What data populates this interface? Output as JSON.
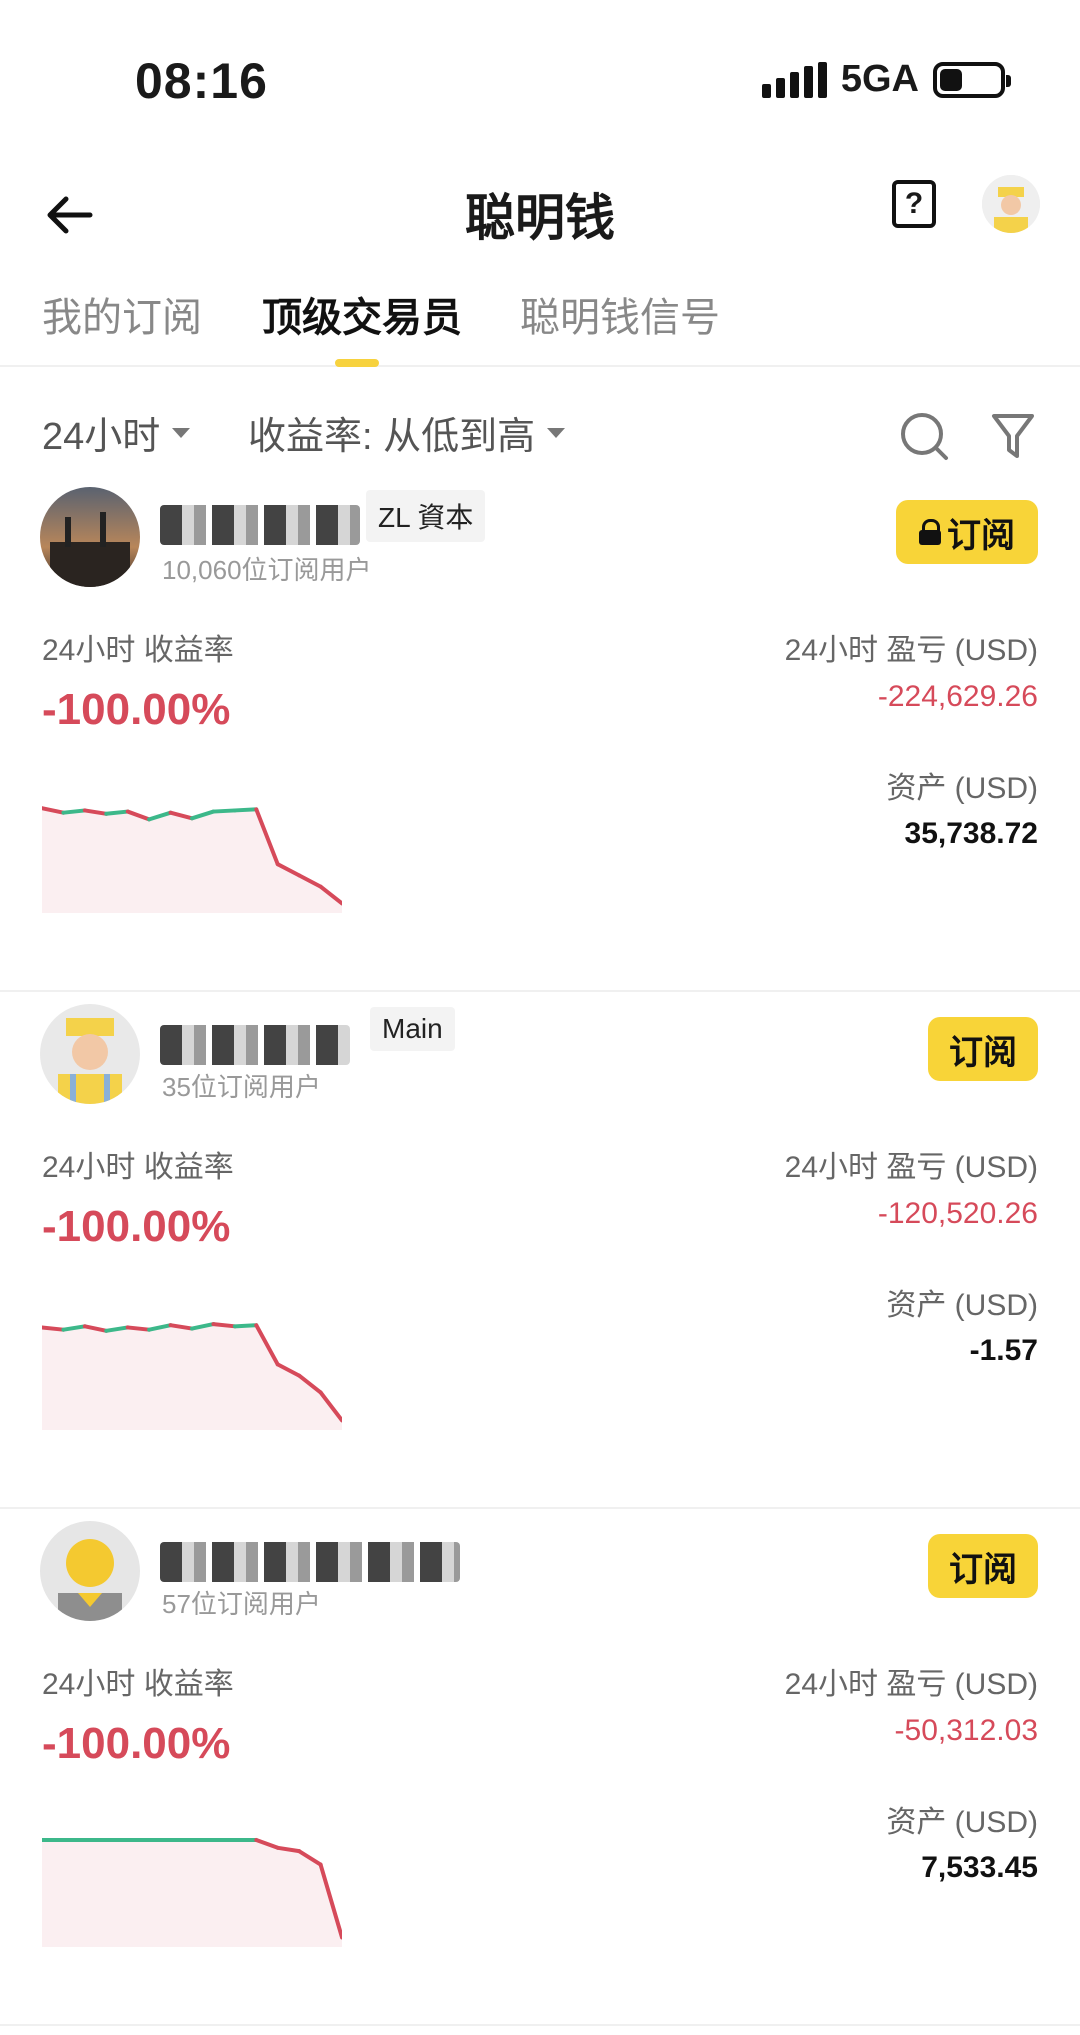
{
  "status": {
    "time": "08:16",
    "network": "5GA"
  },
  "nav": {
    "title": "聪明钱",
    "help_label": "?"
  },
  "tabs": [
    {
      "label": "我的订阅",
      "active": false
    },
    {
      "label": "顶级交易员",
      "active": true
    },
    {
      "label": "聪明钱信号",
      "active": false
    }
  ],
  "filters": {
    "period": "24小时",
    "sort": "收益率: 从低到高"
  },
  "labels": {
    "roi": "24小时 收益率",
    "pnl": "24小时 盈亏 (USD)",
    "assets": "资产 (USD)",
    "subscribe": "订阅"
  },
  "colors": {
    "accent": "#f8d438",
    "negative": "#d64a5a",
    "positive": "#3cb88a"
  },
  "traders": [
    {
      "tag": "ZL 資本",
      "subscribers": "10,060位订阅用户",
      "locked": true,
      "roi": "-100.00%",
      "pnl": "-224,629.26",
      "assets": "35,738.72",
      "sparkline": [
        0.9,
        0.86,
        0.88,
        0.85,
        0.87,
        0.8,
        0.86,
        0.81,
        0.87,
        0.88,
        0.89,
        0.4,
        0.3,
        0.2,
        0.05
      ]
    },
    {
      "tag": "Main",
      "subscribers": "35位订阅用户",
      "locked": false,
      "roi": "-100.00%",
      "pnl": "-120,520.26",
      "assets": "-1.57",
      "sparkline": [
        0.88,
        0.86,
        0.89,
        0.85,
        0.88,
        0.86,
        0.9,
        0.87,
        0.91,
        0.89,
        0.9,
        0.55,
        0.45,
        0.3,
        0.05
      ]
    },
    {
      "tag": "",
      "subscribers": "57位订阅用户",
      "locked": false,
      "roi": "-100.00%",
      "pnl": "-50,312.03",
      "assets": "7,533.45",
      "sparkline": [
        0.92,
        0.92,
        0.92,
        0.92,
        0.92,
        0.92,
        0.92,
        0.92,
        0.92,
        0.92,
        0.92,
        0.85,
        0.82,
        0.7,
        0.05
      ]
    }
  ]
}
